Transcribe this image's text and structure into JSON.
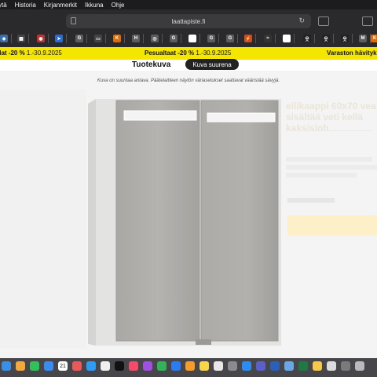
{
  "menubar": {
    "items": [
      "ytä",
      "Historia",
      "Kirjanmerkit",
      "Ikkuna",
      "Ohje"
    ]
  },
  "browser": {
    "url": "laattapiste.fi",
    "page_icon": "page-icon",
    "reload_icon": "↻",
    "bookmarks": [
      {
        "icon": "pin-icon",
        "glyph": "◆",
        "color": "#3b6ea8"
      },
      {
        "icon": "blocks-icon",
        "glyph": "▦",
        "color": "#444"
      },
      {
        "icon": "red-logo-icon",
        "glyph": "◉",
        "color": "#b33"
      },
      {
        "icon": "arrow-icon",
        "glyph": "➤",
        "color": "#2a6bd1"
      },
      {
        "icon": "google-icon",
        "glyph": "G",
        "color": "#5c5c5c"
      },
      {
        "icon": "card-icon",
        "glyph": "▭",
        "color": "#444"
      },
      {
        "icon": "k-icon",
        "glyph": "K",
        "color": "#e36a00"
      },
      {
        "icon": "h-icon",
        "glyph": "H",
        "color": "#5c5c5c"
      },
      {
        "icon": "circle-icon",
        "glyph": "◎",
        "color": "#5c5c5c"
      },
      {
        "icon": "g-icon-2",
        "glyph": "G",
        "color": "#5c5c5c"
      },
      {
        "icon": "grid-icon",
        "glyph": "▣",
        "color": "#fff"
      },
      {
        "icon": "g-icon-3",
        "glyph": "G",
        "color": "#5c5c5c"
      },
      {
        "icon": "g-icon-4",
        "glyph": "G",
        "color": "#5c5c5c"
      },
      {
        "icon": "bolt-icon",
        "glyph": "⚡",
        "color": "#d04a2a"
      },
      {
        "icon": "wave-icon",
        "glyph": "≈",
        "color": "#333"
      },
      {
        "icon": "mountain-icon",
        "glyph": "▲",
        "color": "#fff"
      },
      {
        "icon": "person-icon-1",
        "glyph": "웃",
        "color": "#222"
      },
      {
        "icon": "person-icon-2",
        "glyph": "웃",
        "color": "#222"
      },
      {
        "icon": "person-icon-3",
        "glyph": "웃",
        "color": "#222"
      },
      {
        "icon": "m-icon",
        "glyph": "M",
        "color": "#5c5c5c"
      },
      {
        "icon": "k-icon-2",
        "glyph": "K",
        "color": "#e36a00"
      }
    ]
  },
  "promo": {
    "left_bold": "ilat -20 %",
    "left_rest": " 1.-30.9.2025",
    "mid_bold": "Pesualtaat -20 %",
    "mid_rest": " 1.-30.9.2025",
    "right_bold": "Varaston hävityksl"
  },
  "modal": {
    "tab_active": "Tuotekuva",
    "tab_button": "Kuva suurena",
    "notice": "Kuva on suuntaa antava. Päätelaitteen näytön väriasetukset saattavat vääristää sävyjä.",
    "image_icon": "mirror-cabinet-image"
  },
  "backdrop": {
    "title": "eilikaappi 60x70 vea sisältää veti kellä kaksisioh"
  },
  "dock": {
    "icons": [
      {
        "name": "finder-icon",
        "color": "#3a8ee6"
      },
      {
        "name": "photos-icon",
        "color": "#f2a93b"
      },
      {
        "name": "facetime-icon",
        "color": "#32c158"
      },
      {
        "name": "mail-icon",
        "color": "#3b8cf0"
      },
      {
        "name": "calendar-icon",
        "color": "#ffffff"
      },
      {
        "name": "pinwheel-icon",
        "color": "#e85a5a"
      },
      {
        "name": "safari-icon",
        "color": "#2d9cf2"
      },
      {
        "name": "reminders-icon",
        "color": "#f0f0f0"
      },
      {
        "name": "apple-tv-icon",
        "color": "#111111"
      },
      {
        "name": "music-icon",
        "color": "#f54a6a"
      },
      {
        "name": "podcasts-icon",
        "color": "#a050e0"
      },
      {
        "name": "numbers-icon",
        "color": "#32b35a"
      },
      {
        "name": "keynote-icon",
        "color": "#2b7cf0"
      },
      {
        "name": "pages-icon",
        "color": "#f59c2b"
      },
      {
        "name": "notes-icon",
        "color": "#f7d74a"
      },
      {
        "name": "chrome-icon",
        "color": "#e8e8e8"
      },
      {
        "name": "settings-icon",
        "color": "#8a8a8f"
      },
      {
        "name": "app-store-icon",
        "color": "#2d8cf2"
      },
      {
        "name": "teams-icon",
        "color": "#5b5fc7"
      },
      {
        "name": "word-icon",
        "color": "#2b5fb8"
      },
      {
        "name": "preview-icon",
        "color": "#6aa6e8"
      },
      {
        "name": "excel-icon",
        "color": "#1e7a45"
      },
      {
        "name": "bulb-icon",
        "color": "#f5c84a"
      },
      {
        "name": "files-icon",
        "color": "#dcdcdc"
      },
      {
        "name": "printer-icon",
        "color": "#7a7a7a"
      },
      {
        "name": "trash-icon",
        "color": "#b9b9be"
      }
    ],
    "calendar_day": "21"
  }
}
